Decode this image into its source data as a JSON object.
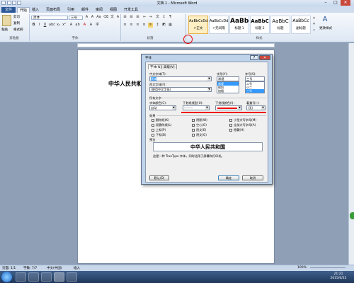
{
  "window": {
    "title": "文档 1 - Microsoft Word",
    "min": "–",
    "max": "□",
    "close": "✕"
  },
  "tabs": [
    "文件",
    "开始",
    "插入",
    "页面布局",
    "引用",
    "邮件",
    "审阅",
    "视图",
    "开发工具"
  ],
  "ribbon": {
    "paste_label": "粘贴",
    "cut_label": "剪切",
    "copy_label": "复制",
    "format_painter_label": "格式刷",
    "font_name": "黑体",
    "font_size": "三号",
    "groups": [
      "剪贴板",
      "字体",
      "段落",
      "样式"
    ],
    "styles": [
      {
        "sample": "AaBbCcDd",
        "name": "↵正文"
      },
      {
        "sample": "AaBbCcDd",
        "name": "↵无间隔"
      },
      {
        "sample": "AaBb",
        "name": "标题 1"
      },
      {
        "sample": "AaBbC",
        "name": "标题 2"
      },
      {
        "sample": "AaBbC",
        "name": "标题"
      },
      {
        "sample": "AaBbCc",
        "name": "副标题"
      }
    ],
    "change_styles_label": "更改样式"
  },
  "document": {
    "text": "中华人民共和国"
  },
  "statusbar": {
    "page": "页面: 1/1",
    "words": "字数: 7/7",
    "lang": "中文(中国)",
    "mode": "插入",
    "zoom": "100%"
  },
  "taskbar": {
    "time": "21:21",
    "date": "2015/6/22"
  },
  "dialog": {
    "title": "字体",
    "tabs": [
      "字体(N)",
      "高级(V)"
    ],
    "cn_font_label": "中文字体(T):",
    "cn_font_value": "黑体",
    "west_font_label": "西文字体(F):",
    "west_font_value": "(使用中文字体)",
    "style_label": "字形(Y):",
    "style_value": "常规",
    "style_options": [
      "常规",
      "倾斜",
      "加粗"
    ],
    "size_label": "字号(S):",
    "size_value": "三号",
    "size_options": [
      "二号",
      "小二",
      "三号"
    ],
    "all_text_label": "所有文字",
    "color_label": "字体颜色(C):",
    "color_value": "自动",
    "underline_type_label": "下划线线型(U):",
    "underline_type_value": "--------",
    "underline_color_label": "下划线颜色(I):",
    "emphasis_label": "着重号(·):",
    "emphasis_value": "(无)",
    "effects_label": "效果",
    "effects_left": [
      "删除线(K)",
      "双删除线(L)",
      "上标(P)",
      "下标(B)"
    ],
    "effects_mid": [
      "阴影(W)",
      "空心(O)",
      "阳文(E)",
      "阴文(G)"
    ],
    "effects_right": [
      "小型大写字母(M)",
      "全部大写字母(A)",
      "隐藏(H)"
    ],
    "preview_label": "预览",
    "preview_text": "中华人民共和国",
    "hint": "这是一种 TrueType 字体，同时适用于屏幕和打印机。",
    "default_btn": "默认(D)",
    "ok_btn": "确定",
    "cancel_btn": "取消"
  },
  "colors": {
    "annotation": "#e00000",
    "underline_color_value": "#e00000",
    "ribbon_blue": "#2b5797"
  }
}
